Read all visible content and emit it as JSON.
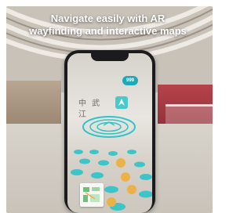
{
  "headline": {
    "line1": "Navigate easily with AR",
    "line2": "wayfinding and interactive maps"
  },
  "phone": {
    "badge_label": "999",
    "signage_text": "中 武 江"
  },
  "icons": [
    "ar-ring-icon",
    "navigation-marker-icon",
    "minimap-icon",
    "coin-icon"
  ],
  "colors": {
    "ar_accent": "#2ec4c9",
    "coin": "#e9b34a",
    "store_red": "#b8424a"
  }
}
